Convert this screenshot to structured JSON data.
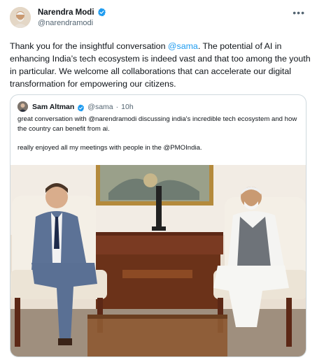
{
  "tweet": {
    "author_name": "Narendra Modi",
    "author_handle": "@narendramodi",
    "more_icon": "ellipsis-icon",
    "text_parts": {
      "before_mention": "Thank you for the insightful conversation ",
      "mention": "@sama",
      "after_mention": ". The potential of AI in enhancing India’s tech ecosystem is indeed vast and that too among the youth in particular. We welcome all collaborations that can accelerate our digital transformation for empowering our citizens."
    }
  },
  "quote": {
    "author_name": "Sam Altman",
    "author_handle": "@sama",
    "separator": "·",
    "time": "10h",
    "text": "great conversation with @narendramodi discussing india's incredible tech ecosystem and how the country can benefit from ai.\n\nreally enjoyed all my meetings with people in the @PMOIndia."
  },
  "colors": {
    "link": "#1d9bf0",
    "verified": "#1d9bf0",
    "text": "#0f1419",
    "secondary": "#536471",
    "border": "#cfd9de"
  }
}
